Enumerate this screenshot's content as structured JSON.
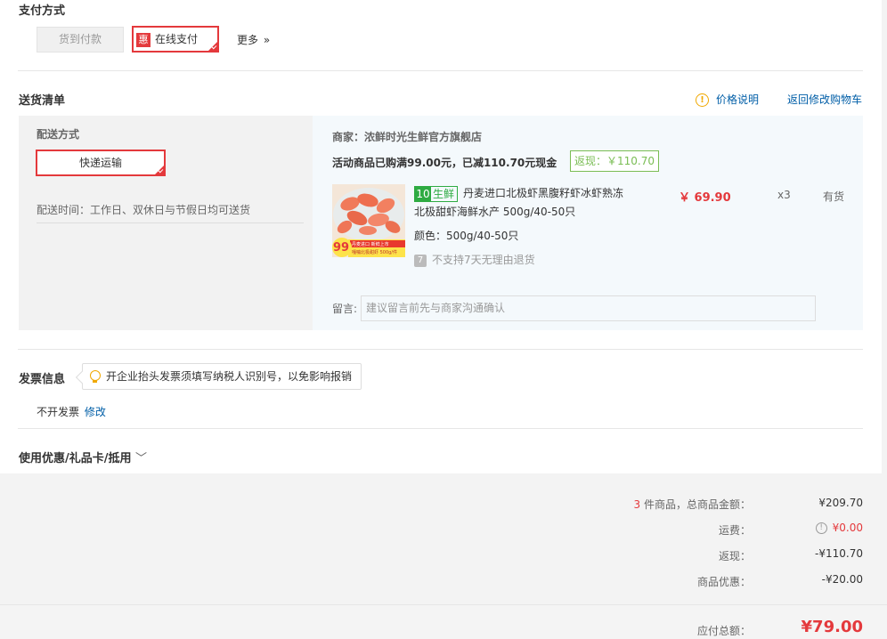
{
  "payment": {
    "title": "支付方式",
    "cod_label": "货到付款",
    "badge": "惠",
    "online_label": "在线支付",
    "more_label": "更多",
    "more_icon": "»"
  },
  "shipping_list": {
    "title": "送货清单",
    "price_info_label": "价格说明",
    "return_cart_label": "返回修改购物车",
    "delivery_method_title": "配送方式",
    "delivery_method_value": "快递运输",
    "delivery_time": "配送时间：工作日、双休日与节假日均可送货",
    "merchant": "商家：浓鲜时光生鲜官方旗舰店",
    "promo_text": "活动商品已购满99.00元，已减110.70元现金",
    "cashback_badge": "返现：￥110.70",
    "product": {
      "tag_icon": "10",
      "tag_text": "生鲜",
      "name_line1": "丹麦进口北极虾黑腹籽虾冰虾熟冻",
      "name_line2": "北极甜虾海鲜水产 500g/40-50只",
      "color": "颜色：500g/40-50只",
      "no_return": "不支持7天无理由退货",
      "no_return_icon": "7",
      "price": "￥ 69.90",
      "qty": "x3",
      "stock": "有货",
      "image_price": "99",
      "image_caption_1": "丹麦进口 新鲜上市",
      "image_caption_2": "嘎嘣北极甜虾 500g/件",
      "image_tag": "到手价"
    },
    "message_label": "留言:",
    "message_placeholder": "建议留言前先与商家沟通确认"
  },
  "invoice": {
    "title": "发票信息",
    "tip": "开企业抬头发票须填写纳税人识别号，以免影响报销",
    "status": "不开发票",
    "modify_label": "修改"
  },
  "coupon": {
    "title": "使用优惠/礼品卡/抵用",
    "chevron": "﹀"
  },
  "summary": {
    "count": "3",
    "count_text": " 件商品，总商品金额：",
    "total_goods": "¥209.70",
    "shipping_label": "运费：",
    "shipping_value": "¥0.00",
    "cashback_label": "返现：",
    "cashback_value": "-¥110.70",
    "discount_label": "商品优惠：",
    "discount_value": "-¥20.00",
    "payable_label": "应付总额：",
    "payable_value": "¥79.00"
  },
  "colors": {
    "accent_red": "#e4393c",
    "link_blue": "#005ea7",
    "green": "#7abd54",
    "fresh_green": "#2eab42",
    "warning_orange": "#f0a800"
  }
}
